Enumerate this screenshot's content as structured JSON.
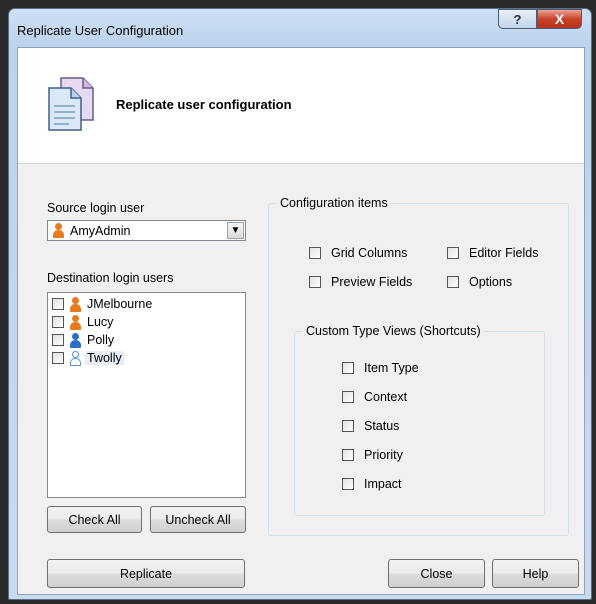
{
  "window": {
    "title": "Replicate User Configuration",
    "help_glyph": "?",
    "close_glyph": "X"
  },
  "banner": {
    "heading": "Replicate user configuration"
  },
  "source": {
    "label": "Source login user",
    "selected": "AmyAdmin"
  },
  "destination": {
    "label": "Destination login users",
    "users": [
      {
        "name": "JMelbourne",
        "checked": false,
        "icon_color": "#e87a1e"
      },
      {
        "name": "Lucy",
        "checked": false,
        "icon_color": "#e87a1e"
      },
      {
        "name": "Polly",
        "checked": false,
        "icon_color": "#2e6fc6"
      },
      {
        "name": "Twolly",
        "checked": false,
        "icon_color": "#7fb2e6"
      }
    ]
  },
  "buttons": {
    "check_all": "Check All",
    "uncheck_all": "Uncheck All",
    "replicate": "Replicate",
    "close": "Close",
    "help": "Help"
  },
  "config_items": {
    "label": "Configuration items",
    "options": {
      "grid_columns": "Grid Columns",
      "editor_fields": "Editor Fields",
      "preview_fields": "Preview Fields",
      "options": "Options"
    }
  },
  "custom_views": {
    "label": "Custom Type Views (Shortcuts)",
    "options": [
      "Item Type",
      "Context",
      "Status",
      "Priority",
      "Impact"
    ]
  },
  "colors": {
    "close_button": "#c7432a",
    "window_frame": "#bcd3ee",
    "dialog_face": "#f0f0f0"
  }
}
